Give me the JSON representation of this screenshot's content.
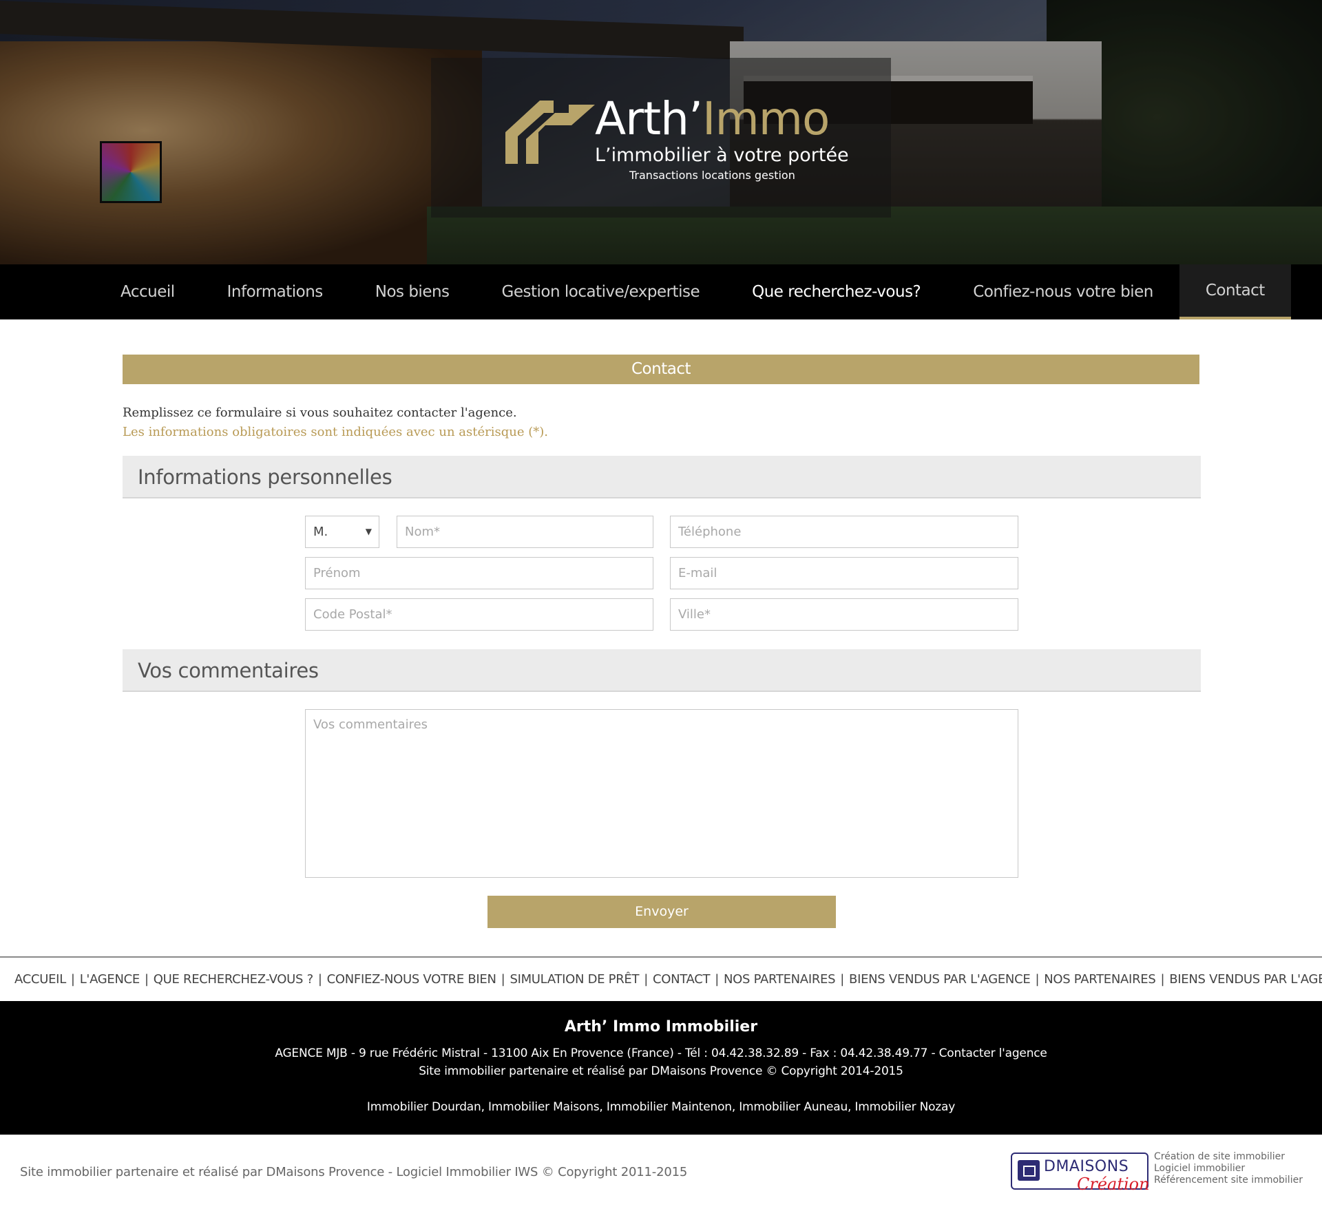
{
  "brand": {
    "name_part1": "Arth’",
    "name_part2": "Immo",
    "tagline": "L’immobilier à votre portée",
    "subtagline": "Transactions locations gestion",
    "accent_color": "#b8a46a"
  },
  "nav": {
    "items": [
      {
        "label": "Accueil"
      },
      {
        "label": "Informations"
      },
      {
        "label": "Nos biens"
      },
      {
        "label": "Gestion locative/expertise"
      },
      {
        "label": "Que recherchez-vous?"
      },
      {
        "label": "Confiez-nous votre bien"
      },
      {
        "label": "Contact"
      }
    ],
    "active": "Contact"
  },
  "page": {
    "title": "Contact",
    "intro": "Remplissez ce formulaire si vous souhaitez contacter l'agence.",
    "required_note": "Les informations obligatoires sont indiquées avec un astérisque (*)."
  },
  "form": {
    "personal_heading": "Informations personnelles",
    "civility_value": "M.",
    "nom_placeholder": "Nom*",
    "telephone_placeholder": "Téléphone",
    "prenom_placeholder": "Prénom",
    "email_placeholder": "E-mail",
    "codepostal_placeholder": "Code Postal*",
    "ville_placeholder": "Ville*",
    "comments_heading": "Vos commentaires",
    "comments_placeholder": "Vos commentaires",
    "submit_label": "Envoyer"
  },
  "footer": {
    "links": [
      "ACCUEIL",
      "L'AGENCE",
      "QUE RECHERCHEZ-VOUS ?",
      "CONFIEZ-NOUS VOTRE BIEN",
      "SIMULATION DE PRÊT",
      "CONTACT",
      "NOS PARTENAIRES",
      "BIENS VENDUS PAR L'AGENCE",
      "NOS PARTENAIRES",
      "BIENS VENDUS PAR L'AGENCE"
    ],
    "agency_title": "Arth’ Immo Immobilier",
    "address_line": "AGENCE MJB - 9 rue Frédéric Mistral - 13100 Aix En Provence (France) - Tél : 04.42.38.32.89 - Fax : 04.42.38.49.77 - Contacter l'agence",
    "partner_line": "Site immobilier partenaire et réalisé par DMaisons Provence © Copyright 2014-2015",
    "cities_line": "Immobilier Dourdan, Immobilier Maisons, Immobilier Maintenon, Immobilier Auneau, Immobilier Nozay",
    "bottom_copy": "Site immobilier partenaire et réalisé par DMaisons Provence - Logiciel Immobilier IWS © Copyright 2011-2015",
    "dm_logo_name": "DMAISONS",
    "dm_logo_script": "Création",
    "dm_services": [
      "Création de site immobilier",
      "Logiciel immobilier",
      "Référencement site immobilier"
    ]
  }
}
